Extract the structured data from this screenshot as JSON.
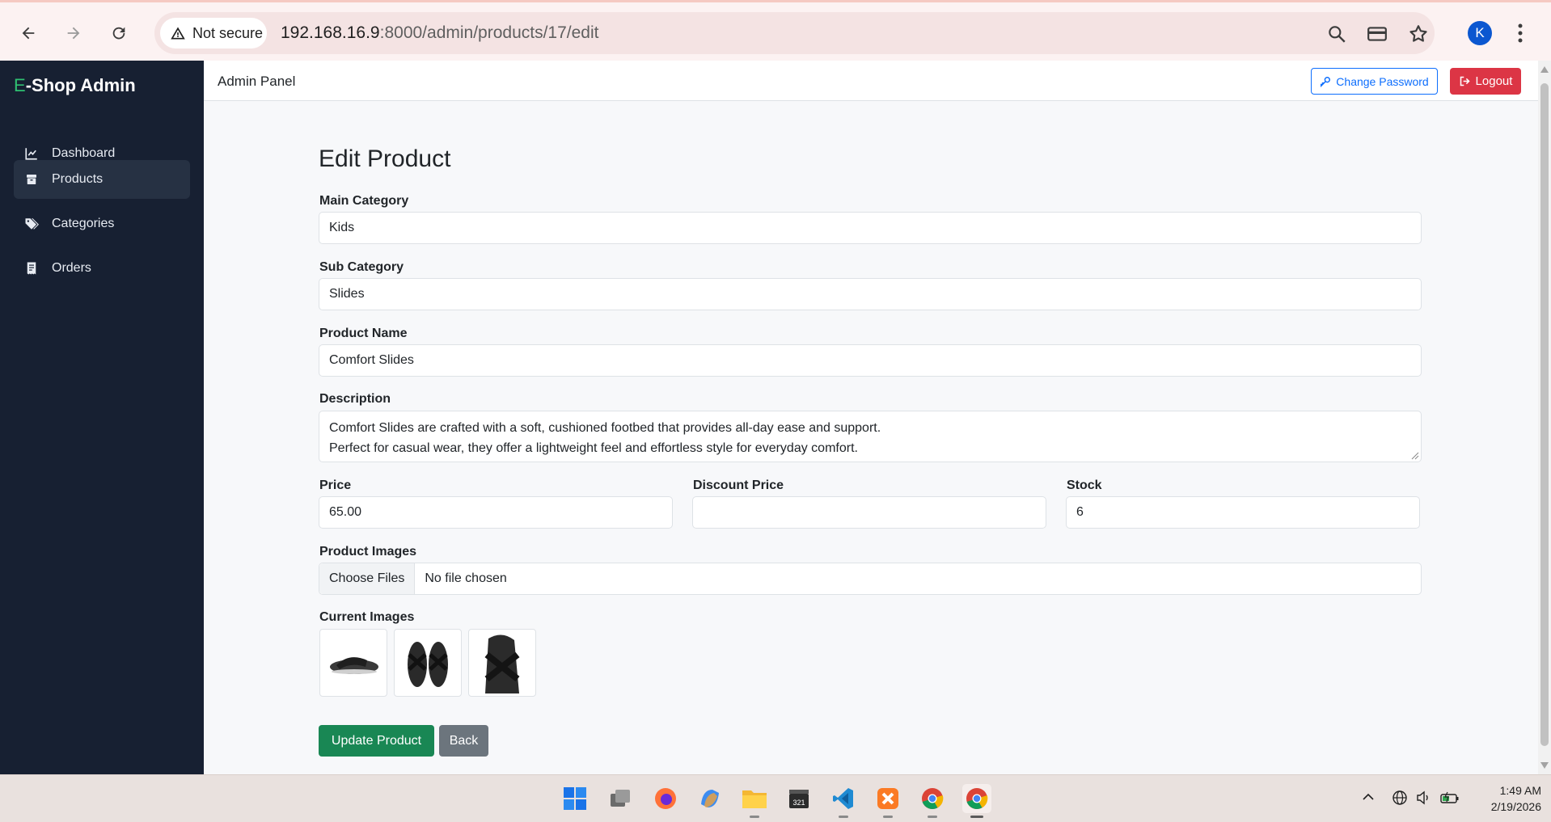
{
  "browser": {
    "security_label": "Not secure",
    "url_host": "192.168.16.9",
    "url_path": ":8000/admin/products/17/edit",
    "profile_initial": "K"
  },
  "sidebar": {
    "brand_prefix": "E",
    "brand_rest": "-Shop Admin",
    "items": [
      {
        "label": "Dashboard",
        "icon": "chart-line-icon"
      },
      {
        "label": "Products",
        "icon": "box-icon",
        "active": true
      },
      {
        "label": "Categories",
        "icon": "tags-icon"
      },
      {
        "label": "Orders",
        "icon": "receipt-icon"
      }
    ]
  },
  "topbar": {
    "title": "Admin Panel",
    "change_password": "Change Password",
    "logout": "Logout"
  },
  "form": {
    "title": "Edit Product",
    "main_category": {
      "label": "Main Category",
      "value": "Kids"
    },
    "sub_category": {
      "label": "Sub Category",
      "value": "Slides"
    },
    "product_name": {
      "label": "Product Name",
      "value": "Comfort Slides"
    },
    "description": {
      "label": "Description",
      "line1": "Comfort Slides are crafted with a soft, cushioned footbed that provides all-day ease and support.",
      "line2": "Perfect for casual wear, they offer a lightweight feel and effortless style for everyday comfort."
    },
    "price": {
      "label": "Price",
      "value": "65.00"
    },
    "discount_price": {
      "label": "Discount Price",
      "value": ""
    },
    "stock": {
      "label": "Stock",
      "value": "6"
    },
    "product_images": {
      "label": "Product Images",
      "button": "Choose Files",
      "status": "No file chosen"
    },
    "current_images": {
      "label": "Current Images"
    },
    "update_button": "Update Product",
    "back_button": "Back"
  },
  "taskbar": {
    "time": "1:49 AM",
    "date": "2/19/2026"
  },
  "colors": {
    "sidebar_bg": "#172032",
    "brand_accent": "#2fbf71",
    "primary": "#0d6efd",
    "danger": "#dc3545",
    "success": "#198754",
    "secondary": "#6c757d"
  }
}
